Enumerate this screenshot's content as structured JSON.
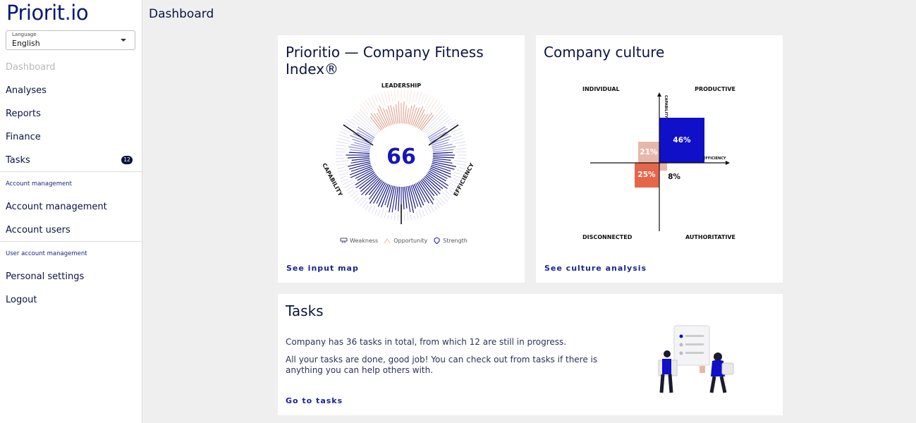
{
  "app": {
    "logo_main": "Priorit",
    "logo_dot": ".",
    "logo_end": "io"
  },
  "language": {
    "label": "Language",
    "value": "English"
  },
  "sidebar": {
    "items": [
      {
        "label": "Dashboard"
      },
      {
        "label": "Analyses"
      },
      {
        "label": "Reports"
      },
      {
        "label": "Finance"
      },
      {
        "label": "Tasks",
        "badge": "12"
      }
    ],
    "section1": "Account management",
    "section1_items": [
      {
        "label": "Account management"
      },
      {
        "label": "Account users"
      }
    ],
    "section2": "User account management",
    "section2_items": [
      {
        "label": "Personal settings"
      },
      {
        "label": "Logout"
      }
    ]
  },
  "header": {
    "title": "Dashboard"
  },
  "fitness": {
    "title": "Prioritio — Company Fitness Index®",
    "score": "66",
    "label_top": "LEADERSHIP",
    "label_left": "CAPABILITY",
    "label_right": "EFFICIENCY",
    "legend": [
      "Weakness",
      "Opportunity",
      "Strength"
    ],
    "link": "See input map"
  },
  "culture": {
    "title": "Company culture",
    "quadrants": {
      "tl": "INDIVIDUAL",
      "tr": "PRODUCTIVE",
      "bl": "DISCONNECTED",
      "br": "AUTHORITATIVE"
    },
    "axis_y": "CAPABILITY",
    "axis_x": "EFFICIENCY",
    "values": {
      "productive": "46%",
      "individual": "21%",
      "disconnected": "25%",
      "authoritative": "8%"
    },
    "link": "See culture analysis"
  },
  "tasks": {
    "title": "Tasks",
    "line1": "Company has 36 tasks in total, from which 12 are still in progress.",
    "line2": "All your tasks are done, good job! You can check out from tasks if there is anything you can help others with.",
    "link": "Go to tasks"
  },
  "colors": {
    "navy": "#0b1440",
    "blue": "#1010c8",
    "salmon": "#e7b8aa",
    "orange": "#e5664a"
  }
}
